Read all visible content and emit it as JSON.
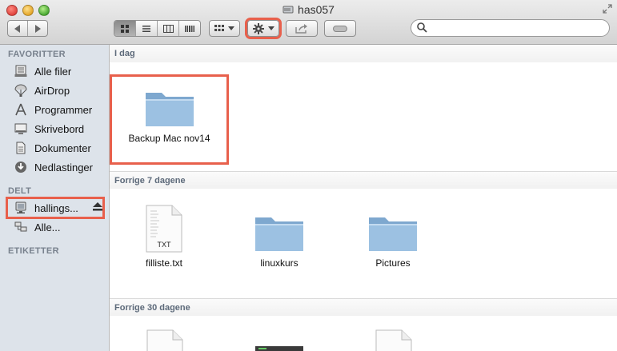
{
  "window": {
    "title": "has057"
  },
  "toolbar": {
    "back_icon": "chevron-left-icon",
    "forward_icon": "chevron-right-icon",
    "view_icons": [
      "icon-view-icon",
      "list-view-icon",
      "column-view-icon",
      "coverflow-view-icon"
    ],
    "arrange_icon": "arrange-grid-icon",
    "action_icon": "gear-icon",
    "share_icon": "share-icon",
    "tag_icon": "tag-icon"
  },
  "search": {
    "placeholder": "",
    "value": ""
  },
  "sidebar": {
    "favorites_header": "FAVORITTER",
    "favorites": [
      {
        "label": "Alle filer",
        "icon": "all-files-icon"
      },
      {
        "label": "AirDrop",
        "icon": "airdrop-icon"
      },
      {
        "label": "Programmer",
        "icon": "applications-icon"
      },
      {
        "label": "Skrivebord",
        "icon": "desktop-icon"
      },
      {
        "label": "Dokumenter",
        "icon": "documents-icon"
      },
      {
        "label": "Nedlastinger",
        "icon": "downloads-icon"
      }
    ],
    "shared_header": "DELT",
    "shared": [
      {
        "label": "hallings...",
        "icon": "server-icon"
      },
      {
        "label": "Alle...",
        "icon": "network-icon"
      }
    ],
    "tags_header": "ETIKETTER"
  },
  "content": {
    "sections": [
      {
        "title": "I dag",
        "items": [
          {
            "name": "Backup Mac nov14",
            "type": "folder"
          }
        ]
      },
      {
        "title": "Forrige 7 dagene",
        "items": [
          {
            "name": "filliste.txt",
            "type": "txt",
            "badge": "TXT"
          },
          {
            "name": "linuxkurs",
            "type": "folder"
          },
          {
            "name": "Pictures",
            "type": "folder"
          }
        ]
      },
      {
        "title": "Forrige 30 dagene",
        "items": []
      }
    ]
  },
  "colors": {
    "highlight": "#e8604c",
    "folder": "#8fb4d6",
    "sidebar_bg": "#dde3ea"
  }
}
